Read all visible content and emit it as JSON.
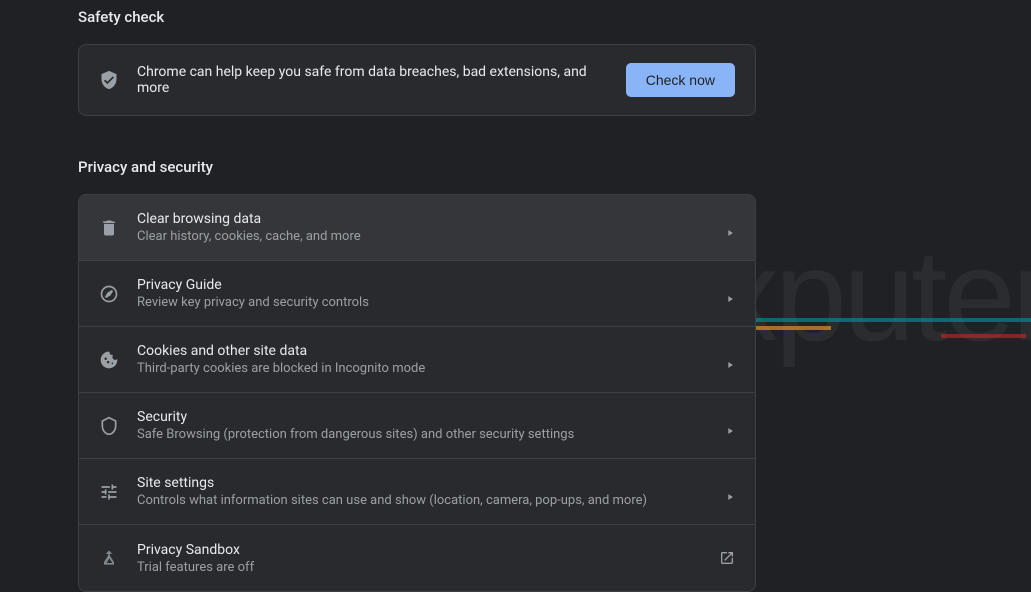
{
  "safety": {
    "heading": "Safety check",
    "description": "Chrome can help keep you safe from data breaches, bad extensions, and more",
    "button": "Check now"
  },
  "privacy": {
    "heading": "Privacy and security",
    "items": [
      {
        "title": "Clear browsing data",
        "sub": "Clear history, cookies, cache, and more"
      },
      {
        "title": "Privacy Guide",
        "sub": "Review key privacy and security controls"
      },
      {
        "title": "Cookies and other site data",
        "sub": "Third-party cookies are blocked in Incognito mode"
      },
      {
        "title": "Security",
        "sub": "Safe Browsing (protection from dangerous sites) and other security settings"
      },
      {
        "title": "Site settings",
        "sub": "Controls what information sites can use and show (location, camera, pop-ups, and more)"
      },
      {
        "title": "Privacy Sandbox",
        "sub": "Trial features are off"
      }
    ]
  },
  "watermark": "exputer"
}
